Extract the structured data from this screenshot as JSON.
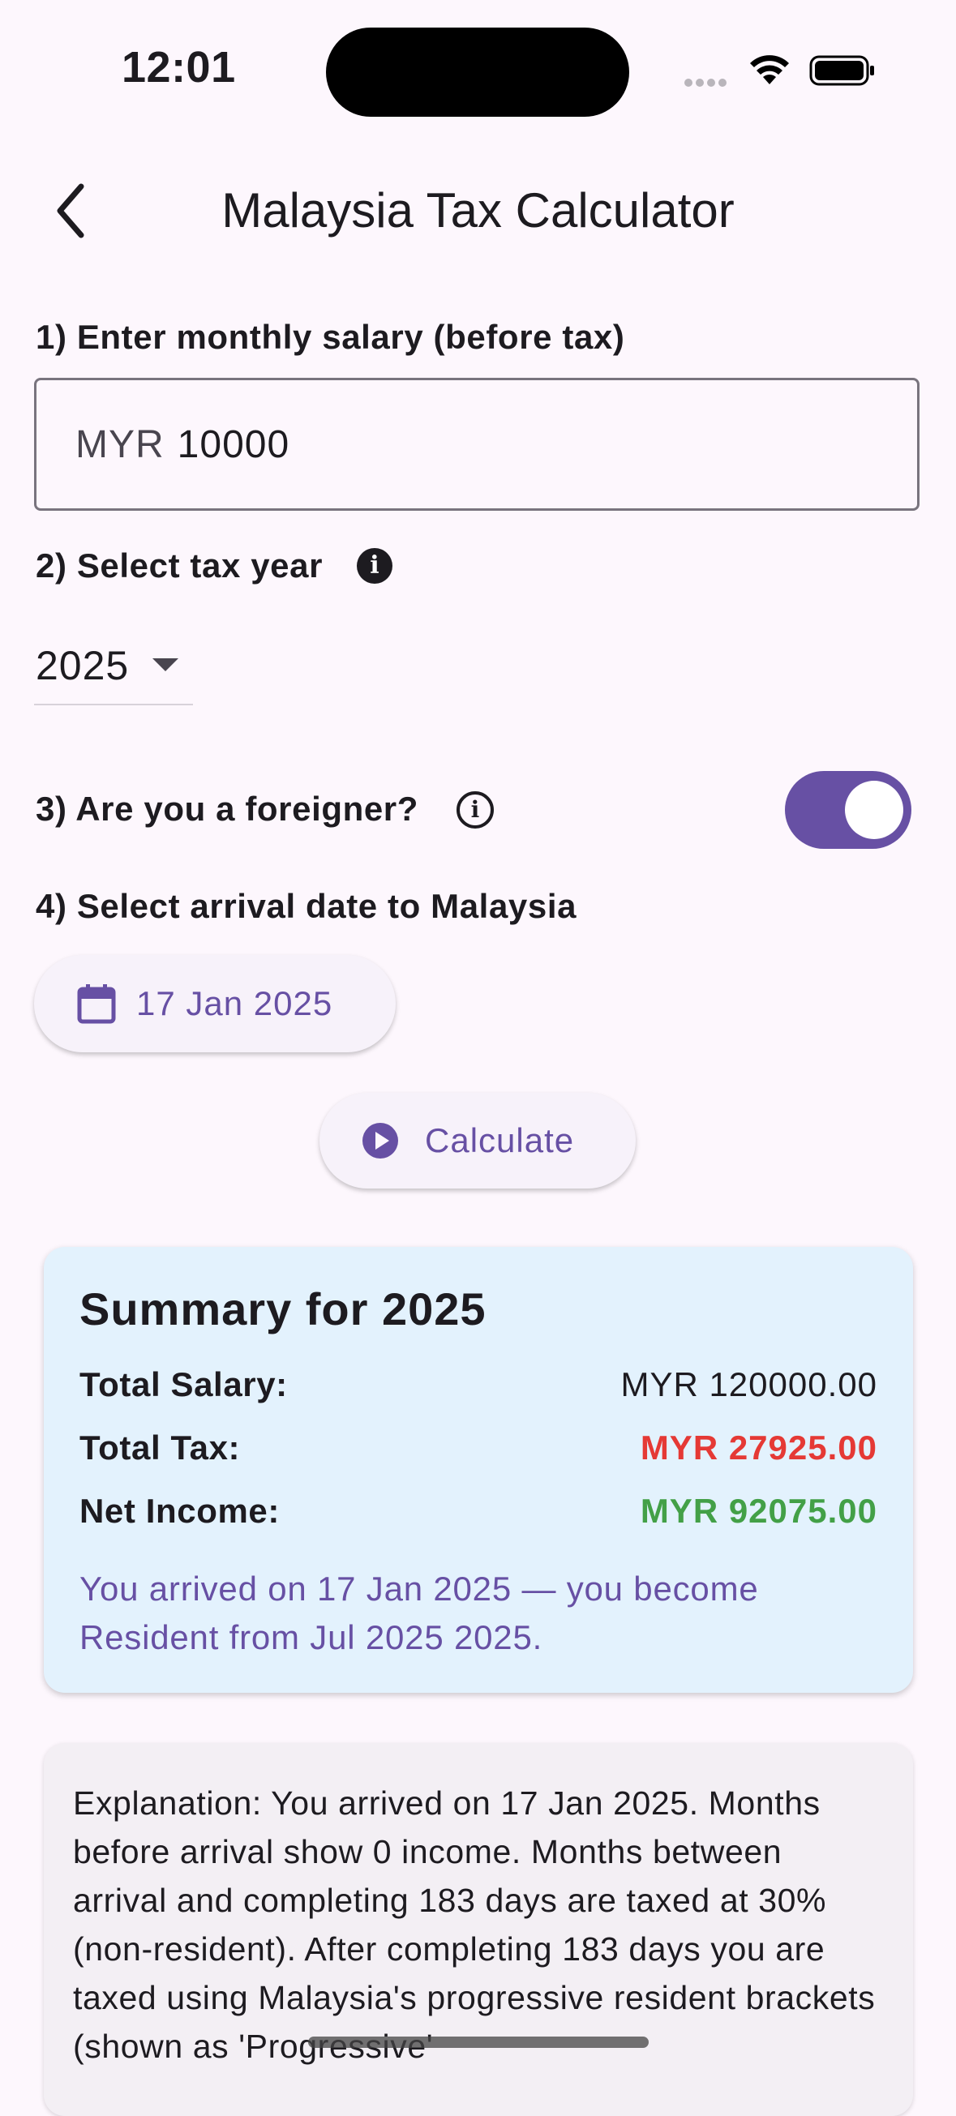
{
  "status_bar": {
    "time": "12:01"
  },
  "app_bar": {
    "title": "Malaysia Tax Calculator"
  },
  "form": {
    "salary_label": "1) Enter monthly salary (before tax)",
    "salary_prefix": "MYR",
    "salary_value": "10000",
    "year_label": "2) Select tax year",
    "year_value": "2025",
    "foreigner_label": "3) Are you a foreigner?",
    "foreigner_on": true,
    "arrival_label": "4) Select arrival date to Malaysia",
    "arrival_date": "17 Jan 2025",
    "calculate_label": "Calculate"
  },
  "summary": {
    "title": "Summary for 2025",
    "rows": [
      {
        "label": "Total Salary:",
        "value": "MYR 120000.00"
      },
      {
        "label": "Total Tax:",
        "value": "MYR 27925.00"
      },
      {
        "label": "Net Income:",
        "value": "MYR 92075.00"
      }
    ],
    "note": "You arrived on 17 Jan 2025 — you become Resident from Jul 2025 2025."
  },
  "explanation": "Explanation: You arrived on 17 Jan 2025. Months before arrival show 0 income. Months between arrival and completing 183 days are taxed at 30% (non-resident). After completing 183 days you are taxed using Malaysia's progressive resident brackets (shown as 'Progressive'",
  "colors": {
    "accent": "#6750a4",
    "tax_red": "#e53935",
    "net_green": "#43a047",
    "summary_bg": "#e3f2fd"
  }
}
